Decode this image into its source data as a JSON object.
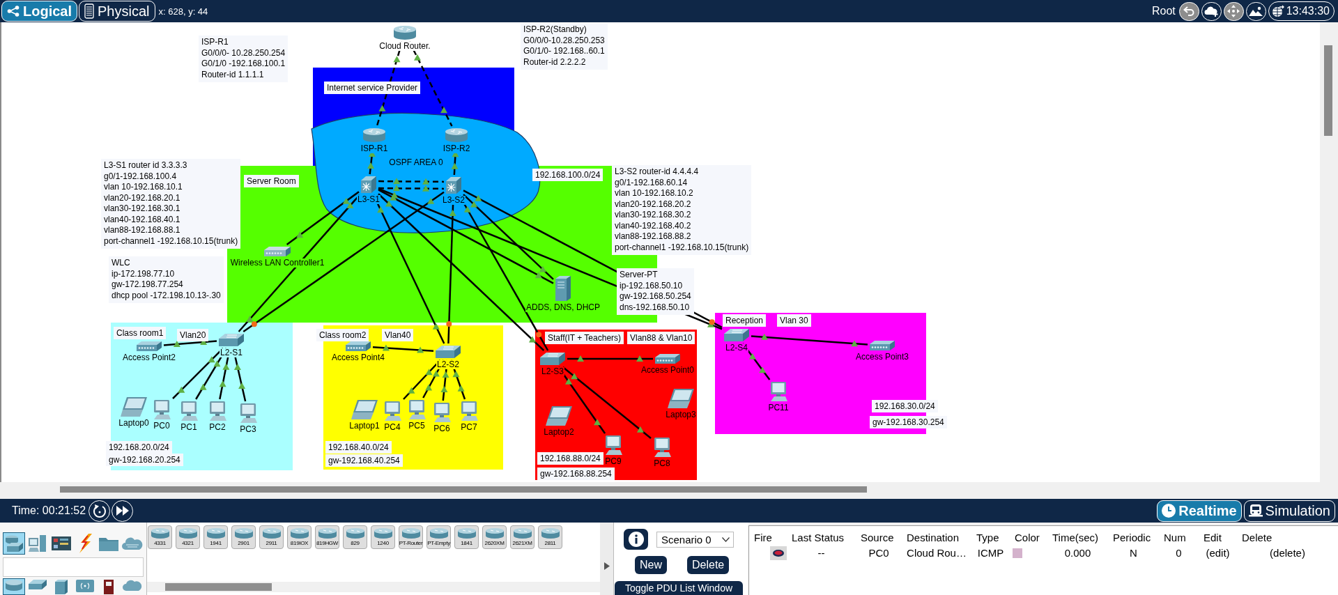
{
  "top_bar": {
    "tabs": [
      {
        "label": "Logical",
        "selected": true
      },
      {
        "label": "Physical",
        "selected": false
      }
    ],
    "cursor": "x: 628, y: 44",
    "location": "Root",
    "clock": "13:43:30"
  },
  "canvas": {
    "areas": [
      {
        "kind": "rectangle",
        "color": "#0000ff"
      },
      {
        "kind": "cloud",
        "color": "#00aaff",
        "label": "OSPF AREA 0"
      },
      {
        "kind": "rectangle",
        "color": "#55ff00"
      },
      {
        "kind": "rectangle",
        "color": "#aaffff"
      },
      {
        "kind": "rectangle",
        "color": "#ffff00"
      },
      {
        "kind": "rectangle",
        "color": "#ff0000"
      },
      {
        "kind": "rectangle",
        "color": "#ff00ff"
      }
    ],
    "notes": [
      {
        "lines": [
          "ISP-R1",
          "G0/0/0- 10.28.250.254",
          "G0/1/0 -192.168.100.1",
          "Router-id 1.1.1.1"
        ]
      },
      {
        "lines": [
          "ISP-R2(Standby)",
          "G0/0/0-10.28.250.253",
          "G0/1/0- 192.168..60.1",
          "Router-id 2.2.2.2"
        ]
      },
      {
        "lines": [
          "Internet service Provider"
        ]
      },
      {
        "lines": [
          "L3-S1 router id 3.3.3.3",
          "g0/1-192.168.100.4",
          "vlan 10-192.168.10.1",
          "vlan20-192.168.20.1",
          "vlan30-192.168.30.1",
          "vlan40-192.168.40.1",
          "vlan88-192.168.88.1",
          "port-channel1 -192.168.10.15(trunk)"
        ]
      },
      {
        "lines": [
          "Server Room"
        ]
      },
      {
        "lines": [
          "192.168.100.0/24"
        ]
      },
      {
        "lines": [
          "L3-S2 router-id 4.4.4.4",
          "g0/1-192.168.60.14",
          "vlan 10-192.168.10.2",
          "vlan20-192.168.20.2",
          "vlan30-192.168.30.2",
          "vlan40-192.168.40.2",
          "vlan88-192.168.88.2",
          "port-channel1 -192.168.10.15(trunk)"
        ]
      },
      {
        "lines": [
          "WLC",
          "ip-172.198.77.10",
          "gw-172.198.77.254",
          "dhcp pool -172.198.10.13-.30"
        ]
      },
      {
        "lines": [
          "Server-PT",
          "ip-192.168.50.10",
          "gw-192.168.50.254",
          "dns-192.168.50.10"
        ]
      },
      {
        "lines": [
          "Reception"
        ]
      },
      {
        "lines": [
          "Vlan 30"
        ]
      },
      {
        "lines": [
          "Class room1"
        ]
      },
      {
        "lines": [
          "Vlan20"
        ]
      },
      {
        "lines": [
          "Class room2"
        ]
      },
      {
        "lines": [
          "Vlan40"
        ]
      },
      {
        "lines": [
          "Staff(IT + Teachers)"
        ]
      },
      {
        "lines": [
          "Vlan88 & Vlan10"
        ]
      },
      {
        "lines": [
          "192.168.30.0/24"
        ]
      },
      {
        "lines": [
          "gw-192.168.30.254"
        ]
      },
      {
        "lines": [
          "192.168.20.0/24"
        ]
      },
      {
        "lines": [
          "gw-192.168.20.254"
        ]
      },
      {
        "lines": [
          "192.168.40.0/24"
        ]
      },
      {
        "lines": [
          "gw-192.168.40.254"
        ]
      },
      {
        "lines": [
          "192.168.88.0/24"
        ]
      },
      {
        "lines": [
          "gw-192.168.88.254"
        ]
      }
    ],
    "devices": [
      {
        "name": "Cloud Router.",
        "kind": "router"
      },
      {
        "name": "ISP-R1",
        "kind": "router"
      },
      {
        "name": "ISP-R2",
        "kind": "router"
      },
      {
        "name": "L3-S1",
        "kind": "l3switch"
      },
      {
        "name": "L3-S2",
        "kind": "l3switch"
      },
      {
        "name": "Wireless LAN Controller1",
        "kind": "wlc"
      },
      {
        "name": "ADDS, DNS, DHCP",
        "kind": "server"
      },
      {
        "name": "L2-S1",
        "kind": "l2switch"
      },
      {
        "name": "Access Point2",
        "kind": "ap"
      },
      {
        "name": "Laptop0",
        "kind": "laptop"
      },
      {
        "name": "PC0",
        "kind": "pc"
      },
      {
        "name": "PC1",
        "kind": "pc"
      },
      {
        "name": "PC2",
        "kind": "pc"
      },
      {
        "name": "PC3",
        "kind": "pc"
      },
      {
        "name": "L2-S2",
        "kind": "l2switch"
      },
      {
        "name": "Access Point4",
        "kind": "ap"
      },
      {
        "name": "Laptop1",
        "kind": "laptop"
      },
      {
        "name": "PC4",
        "kind": "pc"
      },
      {
        "name": "PC5",
        "kind": "pc"
      },
      {
        "name": "PC6",
        "kind": "pc"
      },
      {
        "name": "PC7",
        "kind": "pc"
      },
      {
        "name": "L2-S3",
        "kind": "l2switch"
      },
      {
        "name": "Access Point0",
        "kind": "ap"
      },
      {
        "name": "Laptop2",
        "kind": "laptop"
      },
      {
        "name": "Laptop3",
        "kind": "laptop"
      },
      {
        "name": "PC9",
        "kind": "pc"
      },
      {
        "name": "PC8",
        "kind": "pc"
      },
      {
        "name": "L2-S4",
        "kind": "l2switch"
      },
      {
        "name": "Access Point3",
        "kind": "ap"
      },
      {
        "name": "PC11",
        "kind": "pc"
      }
    ],
    "links": [
      {
        "kind": "crossover",
        "from_blocking": false,
        "to_blocking": false
      },
      {
        "kind": "crossover",
        "from_blocking": false,
        "to_blocking": false
      },
      {
        "kind": "straight",
        "from_blocking": false,
        "to_blocking": false
      },
      {
        "kind": "straight",
        "from_blocking": false,
        "to_blocking": false
      },
      {
        "kind": "crossover",
        "from_blocking": false,
        "to_blocking": false
      },
      {
        "kind": "crossover",
        "from_blocking": false,
        "to_blocking": false
      },
      {
        "kind": "straight",
        "from_blocking": false,
        "to_blocking": false
      },
      {
        "kind": "straight",
        "from_blocking": false,
        "to_blocking": false
      },
      {
        "kind": "straight",
        "from_blocking": false,
        "to_blocking": true
      },
      {
        "kind": "straight",
        "from_blocking": false,
        "to_blocking": false
      },
      {
        "kind": "straight",
        "from_blocking": false,
        "to_blocking": true
      },
      {
        "kind": "straight",
        "from_blocking": false,
        "to_blocking": false
      },
      {
        "kind": "straight",
        "from_blocking": false,
        "to_blocking": true
      },
      {
        "kind": "straight",
        "from_blocking": false,
        "to_blocking": false
      },
      {
        "kind": "straight",
        "from_blocking": false,
        "to_blocking": false
      },
      {
        "kind": "straight",
        "from_blocking": false,
        "to_blocking": false
      },
      {
        "kind": "straight",
        "from_blocking": false,
        "to_blocking": true
      },
      {
        "kind": "straight",
        "from_blocking": false,
        "to_blocking": false
      },
      {
        "kind": "straight",
        "from_blocking": false,
        "to_blocking": false
      },
      {
        "kind": "straight",
        "from_blocking": false,
        "to_blocking": false
      },
      {
        "kind": "straight",
        "from_blocking": false,
        "to_blocking": false
      },
      {
        "kind": "straight",
        "from_blocking": false,
        "to_blocking": false
      },
      {
        "kind": "straight",
        "from_blocking": false,
        "to_blocking": false
      },
      {
        "kind": "straight",
        "from_blocking": false,
        "to_blocking": false
      },
      {
        "kind": "straight",
        "from_blocking": false,
        "to_blocking": false
      },
      {
        "kind": "straight",
        "from_blocking": false,
        "to_blocking": false
      },
      {
        "kind": "straight",
        "from_blocking": false,
        "to_blocking": false
      },
      {
        "kind": "straight",
        "from_blocking": false,
        "to_blocking": false
      },
      {
        "kind": "straight",
        "from_blocking": false,
        "to_blocking": false
      },
      {
        "kind": "straight",
        "from_blocking": false,
        "to_blocking": false
      },
      {
        "kind": "straight",
        "from_blocking": false,
        "to_blocking": false
      },
      {
        "kind": "straight",
        "from_blocking": false,
        "to_blocking": false
      }
    ]
  },
  "time_bar": {
    "time": "Time: 00:21:52",
    "modes": [
      {
        "label": "Realtime",
        "selected": true
      },
      {
        "label": "Simulation",
        "selected": false
      }
    ]
  },
  "device_panel": {
    "categories": [
      {
        "selected": true
      },
      {
        "selected": false
      },
      {
        "selected": false
      },
      {
        "selected": false
      },
      {
        "selected": false
      },
      {
        "selected": false
      }
    ],
    "subcategories": [
      {
        "selected": true
      },
      {
        "selected": false
      },
      {
        "selected": false
      },
      {
        "selected": false
      },
      {
        "selected": false
      },
      {
        "selected": false
      }
    ],
    "models": [
      "4331",
      "4321",
      "1941",
      "2901",
      "2911",
      "819IOX",
      "819HGW",
      "829",
      "1240",
      "PT-Router",
      "PT-Empty",
      "1841",
      "2620XM",
      "2621XM",
      "2811"
    ]
  },
  "scenario_panel": {
    "scenario": "Scenario 0",
    "buttons": [
      "New",
      "Delete"
    ],
    "toggle": "Toggle PDU List Window"
  },
  "pdu_table": {
    "columns": [
      "Fire",
      "Last Status",
      "Source",
      "Destination",
      "Type",
      "Color",
      "Time(sec)",
      "Periodic",
      "Num",
      "Edit",
      "Delete"
    ],
    "rows": [
      {
        "last_status": "--",
        "source": "PC0",
        "destination": "Cloud Rou…",
        "type": "ICMP",
        "color": "#d4b2cc",
        "time": "0.000",
        "periodic": "N",
        "num": "0",
        "edit": "(edit)",
        "delete": "(delete)"
      }
    ]
  }
}
